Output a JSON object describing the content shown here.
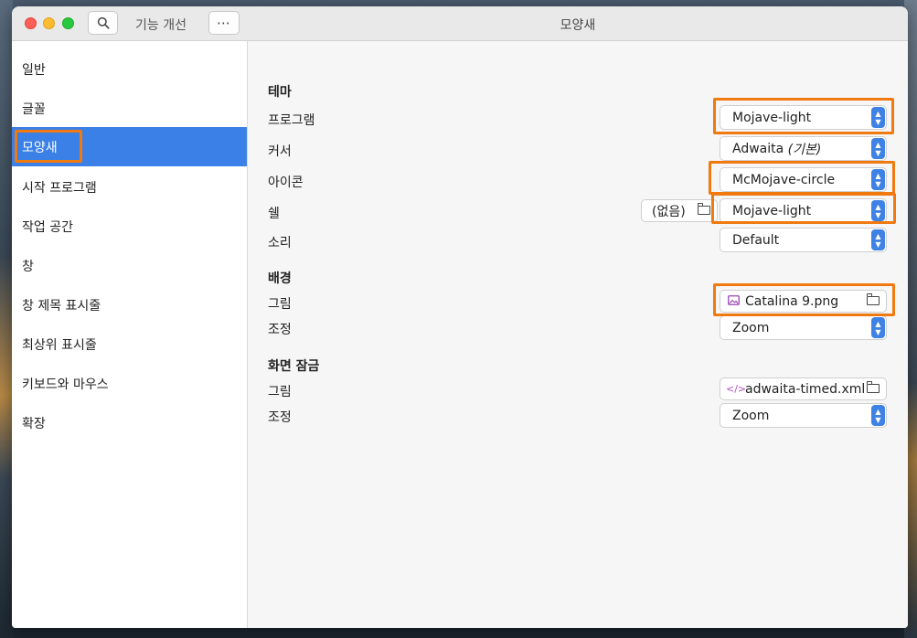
{
  "window": {
    "title": "모양새",
    "toolbar_label": "기능 개선",
    "more_label": "⋯",
    "search_icon": "search-icon"
  },
  "sidebar": {
    "items": [
      {
        "label": "일반"
      },
      {
        "label": "글꼴"
      },
      {
        "label": "모양새",
        "selected": true
      },
      {
        "label": "시작 프로그램"
      },
      {
        "label": "작업 공간"
      },
      {
        "label": "창"
      },
      {
        "label": "창 제목 표시줄"
      },
      {
        "label": "최상위 표시줄"
      },
      {
        "label": "키보드와 마우스"
      },
      {
        "label": "확장"
      }
    ]
  },
  "theme": {
    "heading": "테마",
    "program": {
      "label": "프로그램",
      "value": "Mojave-light"
    },
    "cursor": {
      "label": "커서",
      "value": "Adwaita",
      "value_suffix": "(기본)"
    },
    "icon": {
      "label": "아이콘",
      "value": "McMojave-circle"
    },
    "shell": {
      "label": "쉘",
      "none_label": "(없음)",
      "value": "Mojave-light"
    },
    "sound": {
      "label": "소리",
      "value": "Default"
    }
  },
  "background": {
    "heading": "배경",
    "image": {
      "label": "그림",
      "value": "Catalina 9.png",
      "icon": "image-icon"
    },
    "adjust": {
      "label": "조정",
      "value": "Zoom"
    }
  },
  "lock_screen": {
    "heading": "화면 잠금",
    "image": {
      "label": "그림",
      "value": "adwaita-timed.xml",
      "icon": "xml-file-icon"
    },
    "adjust": {
      "label": "조정",
      "value": "Zoom"
    }
  },
  "colors": {
    "accent": "#3b80e6",
    "highlight": "#f07a10"
  }
}
